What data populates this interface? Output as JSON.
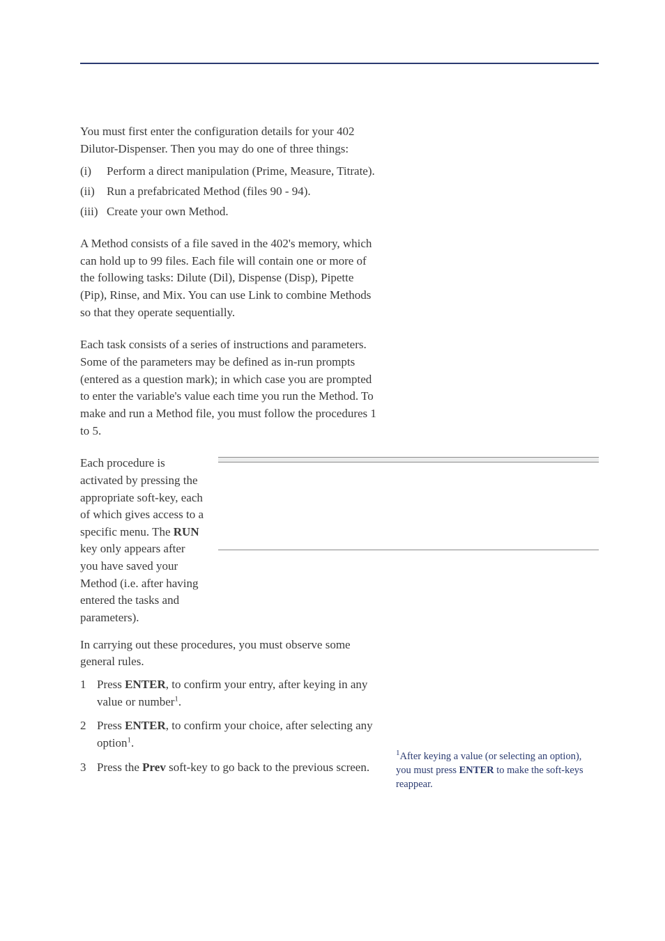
{
  "intro": {
    "p1": "You must first enter the configuration details for your 402 Dilutor-Dispenser. Then you may do one of three things:",
    "items": [
      {
        "mark": "(i)",
        "text": "Perform a direct manipulation (Prime, Measure, Titrate)."
      },
      {
        "mark": "(ii)",
        "text": "Run a prefabricated Method (files 90 - 94)."
      },
      {
        "mark": "(iii)",
        "text": "Create your own Method."
      }
    ]
  },
  "method_para": "A Method consists of a file saved in the 402's memory, which can hold up to 99 files. Each file will contain one or more of the following tasks: Dilute (Dil), Dispense (Disp), Pipette (Pip), Rinse, and Mix. You can use Link to combine Methods so that they operate sequentially.",
  "task_para": "Each task consists of a series of instructions and parameters. Some of the parameters may be defined as in-run prompts (entered as a question mark); in which case you are prompted to enter the variable's value each time you run the Method. To make and run a Method file, you must follow the procedures 1 to 5.",
  "procedure_left": {
    "p1a": "Each procedure is activated by pressing the appropriate soft-key, each of which gives access to a specific menu. The ",
    "bold": "RUN",
    "p1b": " key only appears after you have saved your Method (i.e. after having entered the tasks and parameters)."
  },
  "carry_out": "In carrying out these procedures, you must observe some general rules.",
  "rules": [
    {
      "num": "1",
      "pre": "Press ",
      "b": "ENTER",
      "mid": ", to confirm your entry, after keying in any value or number",
      "sup": "1",
      "post": "."
    },
    {
      "num": "2",
      "pre": "Press ",
      "b": "ENTER",
      "mid": ", to confirm your choice, after selecting any option",
      "sup": "1",
      "post": "."
    },
    {
      "num": "3",
      "pre": "Press the ",
      "b": "Prev",
      "mid": " soft-key to go back to the previous screen.",
      "sup": "",
      "post": ""
    }
  ],
  "footnote": {
    "sup": "1",
    "pre": "After keying a value (or selecting an option), you must press ",
    "b": "ENTER",
    "post": " to make the soft-keys reappear."
  }
}
